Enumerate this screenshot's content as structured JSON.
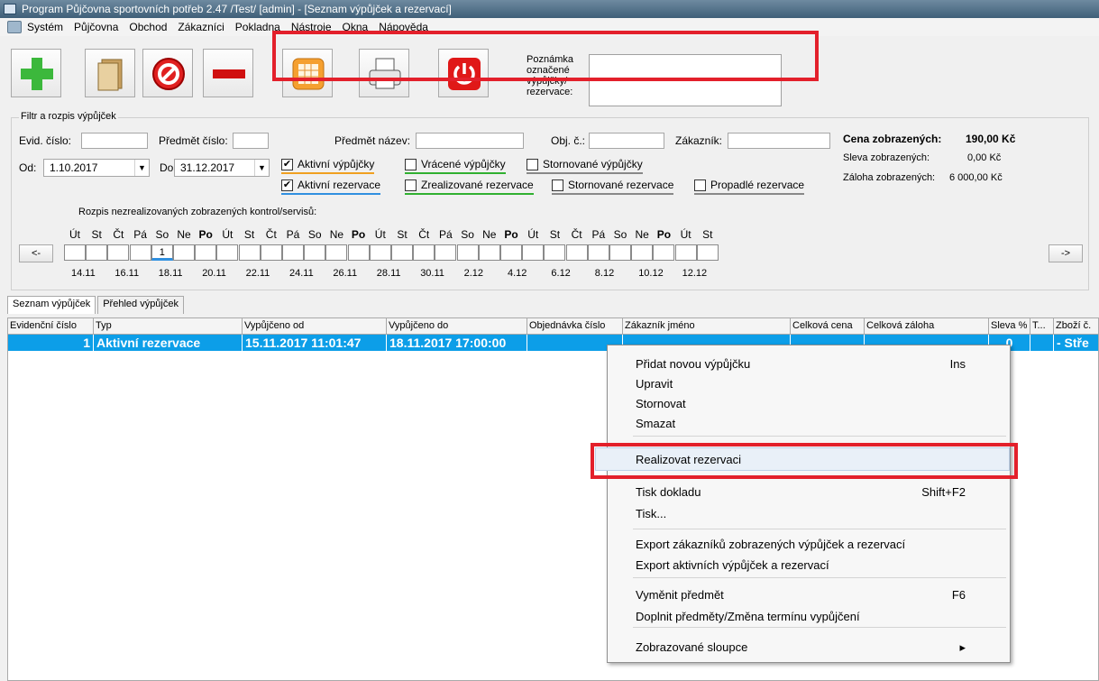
{
  "window": {
    "title": "Program Půjčovna sportovních potřeb 2.47 /Test/ [admin] - [Seznam výpůjček a rezervací]"
  },
  "menu": [
    "Systém",
    "Půjčovna",
    "Obchod",
    "Zákazníci",
    "Pokladna",
    "Nástroje",
    "Okna",
    "Nápověda"
  ],
  "toolbar": {
    "note_label": "Poznámka označené výpůjčky/ rezervace:",
    "buttons": [
      "add-icon",
      "document-icon",
      "cancel-icon",
      "minus-icon",
      "calendar-icon",
      "printer-icon",
      "power-icon"
    ]
  },
  "filter": {
    "legend": "Filtr a rozpis výpůjček",
    "evid_label": "Evid. číslo:",
    "predmet_cislo_label": "Předmět číslo:",
    "predmet_nazev_label": "Předmět název:",
    "obj_label": "Obj. č.:",
    "zakaznik_label": "Zákazník:",
    "od_label": "Od:",
    "od_value": "1.10.2017",
    "do_label": "Do:",
    "do_value": "31.12.2017",
    "checkboxes": [
      {
        "label": "Aktivní výpůjčky",
        "checked": true,
        "color": "#f0a020"
      },
      {
        "label": "Vrácené výpůjčky",
        "checked": false,
        "color": "#30b030"
      },
      {
        "label": "Stornované výpůjčky",
        "checked": false,
        "color": "#888888"
      },
      {
        "label": "Aktivní rezervace",
        "checked": true,
        "color": "#3090e0"
      },
      {
        "label": "Zrealizované rezervace",
        "checked": false,
        "color": "#30b030"
      },
      {
        "label": "Stornované rezervace",
        "checked": false,
        "color": "#888888"
      },
      {
        "label": "Propadlé rezervace",
        "checked": false,
        "color": "#888888"
      }
    ],
    "check_mark": "✔",
    "summary": {
      "cena_label": "Cena zobrazených:",
      "cena_value": "190,00 Kč",
      "sleva_label": "Sleva zobrazených:",
      "sleva_value": "0,00 Kč",
      "zaloha_label": "Záloha zobrazených:",
      "zaloha_value": "6 000,00 Kč"
    },
    "calendar": {
      "title": "Rozpis nezrealizovaných zobrazených kontrol/servisů:",
      "prev": "<-",
      "next": "->",
      "days": [
        "Út",
        "St",
        "Čt",
        "Pá",
        "So",
        "Ne",
        "Po",
        "Út",
        "St",
        "Čt",
        "Pá",
        "So",
        "Ne",
        "Po",
        "Út",
        "St",
        "Čt",
        "Pá",
        "So",
        "Ne",
        "Po",
        "Út",
        "St",
        "Čt",
        "Pá",
        "So",
        "Ne",
        "Po",
        "Út",
        "St"
      ],
      "cell_values": [
        "",
        "",
        "",
        "",
        "1",
        "",
        "",
        "",
        "",
        "",
        "",
        "",
        "",
        "",
        "",
        "",
        "",
        "",
        "",
        "",
        "",
        "",
        "",
        "",
        "",
        "",
        "",
        "",
        "",
        ""
      ],
      "dates": [
        "14.11",
        "16.11",
        "18.11",
        "20.11",
        "22.11",
        "24.11",
        "26.11",
        "28.11",
        "30.11",
        "2.12",
        "4.12",
        "6.12",
        "8.12",
        "10.12",
        "12.12"
      ]
    }
  },
  "tabs": [
    "Seznam výpůjček",
    "Přehled výpůjček"
  ],
  "grid": {
    "columns": [
      "Evidenční číslo",
      "Typ",
      "Vypůjčeno od",
      "Vypůjčeno do",
      "Objednávka číslo",
      "Zákazník jméno",
      "Celková cena",
      "Celková záloha",
      "Sleva %",
      "T...",
      "Zboží č."
    ],
    "row": [
      "1",
      "Aktivní rezervace",
      "15.11.2017 11:01:47",
      "18.11.2017 17:00:00",
      "",
      "",
      "",
      "",
      "0",
      "",
      "- Stře"
    ]
  },
  "context_menu": [
    {
      "label": "Přidat novou výpůjčku",
      "shortcut": "Ins"
    },
    {
      "label": "Upravit",
      "shortcut": ""
    },
    {
      "label": "Stornovat",
      "shortcut": ""
    },
    {
      "label": "Smazat",
      "shortcut": ""
    },
    {
      "label": "Realizovat rezervaci",
      "shortcut": ""
    },
    {
      "label": "Tisk dokladu",
      "shortcut": "Shift+F2"
    },
    {
      "label": "Tisk...",
      "shortcut": ""
    },
    {
      "label": "Export zákazníků zobrazených výpůjček a rezervací",
      "shortcut": ""
    },
    {
      "label": "Export aktivních výpůjček a rezervací",
      "shortcut": ""
    },
    {
      "label": "Vyměnit předmět",
      "shortcut": "F6"
    },
    {
      "label": "Doplnit předměty/Změna termínu vypůjčení",
      "shortcut": ""
    },
    {
      "label": "Zobrazované sloupce",
      "shortcut": "▸"
    }
  ],
  "colors": {
    "accent_red": "#e3202b",
    "selection_blue": "#0c9ee8"
  }
}
